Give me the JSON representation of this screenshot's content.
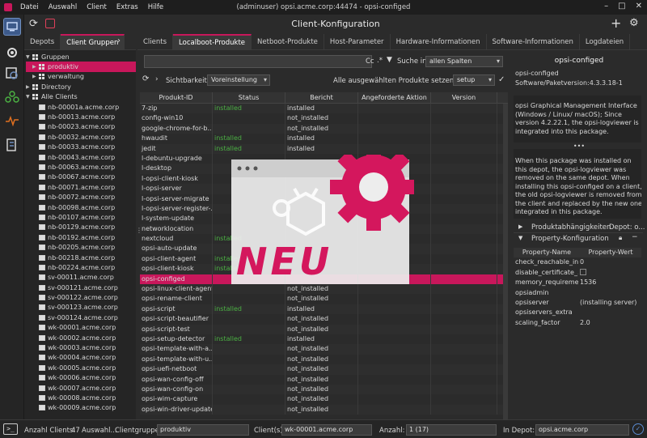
{
  "menubar": {
    "items": [
      "Datei",
      "Auswahl",
      "Client",
      "Extras",
      "Hilfe"
    ],
    "title": "(adminuser) opsi.acme.corp:44474 - opsi-configed"
  },
  "toolbar": {
    "title": "Client-Konfiguration"
  },
  "lefttabs": [
    "Depots",
    "Client Gruppen"
  ],
  "maintabs": [
    "Clients",
    "Localboot-Produkte",
    "Netboot-Produkte",
    "Host-Parameter",
    "Hardware-Informationen",
    "Software-Informationen",
    "Logdateien"
  ],
  "tree": {
    "groups_label": "Gruppen",
    "produktiv": "produktiv",
    "verwaltung": "verwaltung",
    "directory": "Directory",
    "alle": "Alle Clients",
    "clients": [
      "nb-00001a.acme.corp",
      "nb-00013.acme.corp",
      "nb-00023.acme.corp",
      "nb-00032.acme.corp",
      "nb-00033.acme.corp",
      "nb-00043.acme.corp",
      "nb-00063.acme.corp",
      "nb-00067.acme.corp",
      "nb-00071.acme.corp",
      "nb-00072.acme.corp",
      "nb-00098.acme.corp",
      "nb-00107.acme.corp",
      "nb-00129.acme.corp",
      "nb-00192.acme.corp",
      "nb-00205.acme.corp",
      "nb-00218.acme.corp",
      "nb-00224.acme.corp",
      "sv-00011.acme.corp",
      "sv-000121.acme.corp",
      "sv-000122.acme.corp",
      "sv-000123.acme.corp",
      "sv-000124.acme.corp",
      "wk-00001.acme.corp",
      "wk-00002.acme.corp",
      "wk-00003.acme.corp",
      "wk-00004.acme.corp",
      "wk-00005.acme.corp",
      "wk-00006.acme.corp",
      "wk-00007.acme.corp",
      "wk-00008.acme.corp",
      "wk-00009.acme.corp"
    ]
  },
  "filter": {
    "cc": "Cc",
    "regex": ".*",
    "search_in_label": "Suche in",
    "search_in_value": "allen Spalten"
  },
  "visibility": {
    "label": "Sichtbarkeit:",
    "value": "Voreinstellung",
    "setall_label": "Alle ausgewählten Produkte setzen auf",
    "setall_value": "setup"
  },
  "table": {
    "headers": [
      "Produkt-ID",
      "Status",
      "Bericht",
      "Angeforderte Aktion",
      "Version"
    ],
    "rows": [
      [
        "7-zip",
        "installed",
        "installed"
      ],
      [
        "config-win10",
        "",
        "not_installed"
      ],
      [
        "google-chrome-for-b...",
        "",
        "not_installed"
      ],
      [
        "hwaudit",
        "installed",
        "installed"
      ],
      [
        "jedit",
        "installed",
        "installed"
      ],
      [
        "l-debuntu-upgrade",
        "",
        ""
      ],
      [
        "l-desktop",
        "",
        ""
      ],
      [
        "l-opsi-client-kiosk",
        "",
        ""
      ],
      [
        "l-opsi-server",
        "",
        ""
      ],
      [
        "l-opsi-server-migrate",
        "",
        ""
      ],
      [
        "l-opsi-server-register-...",
        "",
        ""
      ],
      [
        "l-system-update",
        "",
        ""
      ],
      [
        "networklocation",
        "",
        ""
      ],
      [
        "nextcloud",
        "installed",
        ""
      ],
      [
        "opsi-auto-update",
        "",
        ""
      ],
      [
        "opsi-client-agent",
        "installed",
        ""
      ],
      [
        "opsi-client-kiosk",
        "installed",
        ""
      ],
      [
        "opsi-configed",
        "",
        ""
      ],
      [
        "opsi-linux-client-agent",
        "",
        "not_installed"
      ],
      [
        "opsi-rename-client",
        "",
        "not_installed"
      ],
      [
        "opsi-script",
        "installed",
        "installed"
      ],
      [
        "opsi-script-beautifier",
        "",
        "not_installed"
      ],
      [
        "opsi-script-test",
        "",
        "not_installed"
      ],
      [
        "opsi-setup-detector",
        "installed",
        "installed"
      ],
      [
        "opsi-template-with-a...",
        "",
        "not_installed"
      ],
      [
        "opsi-template-with-u...",
        "",
        "not_installed"
      ],
      [
        "opsi-uefi-netboot",
        "",
        "not_installed"
      ],
      [
        "opsi-wan-config-off",
        "",
        "not_installed"
      ],
      [
        "opsi-wan-config-on",
        "",
        "not_installed"
      ],
      [
        "opsi-wim-capture",
        "",
        "not_installed"
      ],
      [
        "opsi-win-driver-update",
        "",
        "not_installed"
      ]
    ]
  },
  "details": {
    "title": "opsi-configed",
    "product": "opsi-configed",
    "version_line": "Software/Paketversion:4.3.3.18-1",
    "description": "opsi Graphical Management Interface (Windows / Linux/ macOS); Since version 4.2.22.1, the opsi-logviewer is integrated into this package.",
    "advice": "When this package was installed on this depot, the opsi-logviewer was removed on the same depot. When installing this opsi-configed on a client, the old opsi-logviewer is removed from the client and replaced by the new one integrated in this package.",
    "deps_label": "Produktabhängigkeiten",
    "depot_label": "Depot: o...",
    "propconf_label": "Property-Konfiguration",
    "prop_headers": [
      "Property-Name",
      "Property-Wert"
    ],
    "props": [
      [
        "check_reachable_in...",
        "0"
      ],
      [
        "disable_certificate_...",
        ""
      ],
      [
        "memory_requireme...",
        "1536"
      ],
      [
        "opsiadmin",
        ""
      ],
      [
        "opsiserver",
        "(installing server)"
      ],
      [
        "opsiservers_extra",
        ""
      ],
      [
        "scaling_factor",
        "2.0"
      ]
    ]
  },
  "overlay": {
    "text": "NEU"
  },
  "status": {
    "count_label": "Anzahl Clients:",
    "count": "47",
    "auswahl_label": "Auswahl...",
    "group_label": "Clientgruppe:",
    "group": "produktiv",
    "clients_label": "Client(s):",
    "clients": "wk-00001.acme.corp",
    "anzahl_label": "Anzahl:",
    "anzahl": "1 (17)",
    "depot_label": "In Depot:",
    "depot": "opsi.acme.corp"
  }
}
